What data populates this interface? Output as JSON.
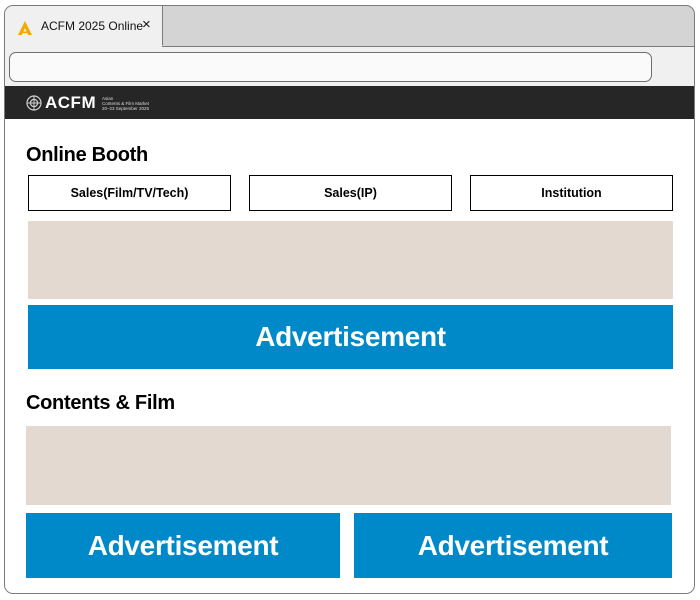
{
  "browser": {
    "tab": {
      "title": "ACFM 2025 Online",
      "close_label": "×",
      "icon": "acfm-triangle-logo"
    },
    "address_bar": {
      "value": "",
      "placeholder": ""
    }
  },
  "site_header": {
    "brand": "ACFM",
    "tagline_line1": "Asian",
    "tagline_line2": "Contents & Film Market",
    "tagline_line3": "20–23 September 2025",
    "logo_icon": "acfm-circle-logo",
    "background": "#262626"
  },
  "online_booth": {
    "title": "Online Booth",
    "tabs": [
      {
        "label": "Sales(Film/TV/Tech)"
      },
      {
        "label": "Sales(IP)"
      },
      {
        "label": "Institution"
      }
    ],
    "advertisement": "Advertisement"
  },
  "contents_film": {
    "title": "Contents & Film",
    "advertisements": [
      "Advertisement",
      "Advertisement"
    ]
  },
  "colors": {
    "accent_ad": "#0089c8",
    "placeholder": "#e3d9d1",
    "tab_logo": "#f5a800"
  }
}
